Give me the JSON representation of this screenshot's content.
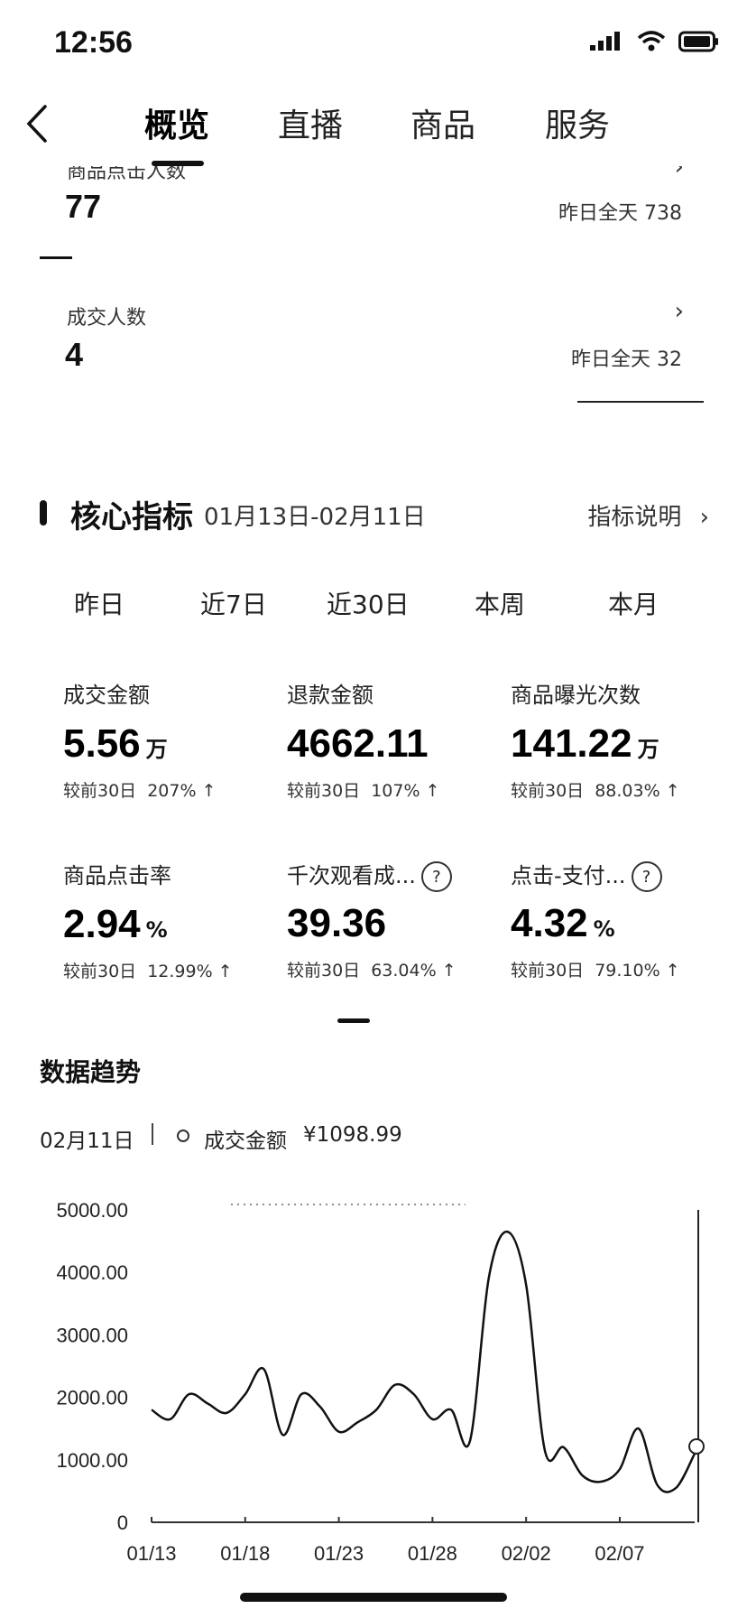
{
  "status_bar": {
    "time": "12:56"
  },
  "nav": {
    "tabs": [
      {
        "label": "概览",
        "active": true
      },
      {
        "label": "直播",
        "active": false
      },
      {
        "label": "商品",
        "active": false
      },
      {
        "label": "服务",
        "active": false
      }
    ]
  },
  "stats": [
    {
      "label": "商品点击人数",
      "value": "77",
      "yesterday": "昨日全天 738"
    },
    {
      "label": "成交人数",
      "value": "4",
      "yesterday": "昨日全天 32"
    }
  ],
  "core": {
    "title": "核心指标",
    "date_range": "01月13日-02月11日",
    "help": "指标说明",
    "ranges": [
      "昨日",
      "近7日",
      "近30日",
      "本周",
      "本月"
    ],
    "metrics": [
      {
        "label": "成交金额",
        "value": "5.56",
        "unit": "万",
        "cmp_label": "较前30日",
        "cmp_pct": "207%",
        "help": false
      },
      {
        "label": "退款金额",
        "value": "4662.11",
        "unit": "",
        "cmp_label": "较前30日",
        "cmp_pct": "107%",
        "help": false
      },
      {
        "label": "商品曝光次数",
        "value": "141.22",
        "unit": "万",
        "cmp_label": "较前30日",
        "cmp_pct": "88.03%",
        "help": false
      },
      {
        "label": "商品点击率",
        "value": "2.94",
        "unit": "%",
        "cmp_label": "较前30日",
        "cmp_pct": "12.99%",
        "help": false
      },
      {
        "label": "千次观看成...",
        "value": "39.36",
        "unit": "",
        "cmp_label": "较前30日",
        "cmp_pct": "63.04%",
        "help": true
      },
      {
        "label": "点击-支付...",
        "value": "4.32",
        "unit": "%",
        "cmp_label": "较前30日",
        "cmp_pct": "79.10%",
        "help": true
      }
    ]
  },
  "trend": {
    "title": "数据趋势",
    "selected_date": "02月11日",
    "series_label": "成交金额",
    "selected_value": "¥1098.99"
  },
  "chart_data": {
    "type": "line",
    "x": [
      "01/13",
      "01/14",
      "01/15",
      "01/16",
      "01/17",
      "01/18",
      "01/19",
      "01/20",
      "01/21",
      "01/22",
      "01/23",
      "01/24",
      "01/25",
      "01/26",
      "01/27",
      "01/28",
      "01/29",
      "01/30",
      "01/31",
      "02/01",
      "02/02",
      "02/03",
      "02/04",
      "02/05",
      "02/06",
      "02/07",
      "02/08",
      "02/09",
      "02/10",
      "02/11"
    ],
    "series": [
      {
        "name": "成交金额",
        "values": [
          1800,
          1650,
          2050,
          1900,
          1750,
          2050,
          2450,
          1400,
          2050,
          1850,
          1450,
          1600,
          1800,
          2200,
          2050,
          1650,
          1800,
          1300,
          3900,
          4650,
          3800,
          1150,
          1200,
          750,
          650,
          850,
          1500,
          600,
          550,
          1099
        ]
      }
    ],
    "tick_labels": [
      "01/13",
      "01/18",
      "01/23",
      "01/28",
      "02/02",
      "02/07"
    ],
    "y_ticks": [
      "0",
      "1000.00",
      "2000.00",
      "3000.00",
      "4000.00",
      "5000.00"
    ],
    "ylim": [
      0,
      5000
    ],
    "grid": false
  },
  "colors": {
    "line": "#111111",
    "text": "#222222"
  }
}
